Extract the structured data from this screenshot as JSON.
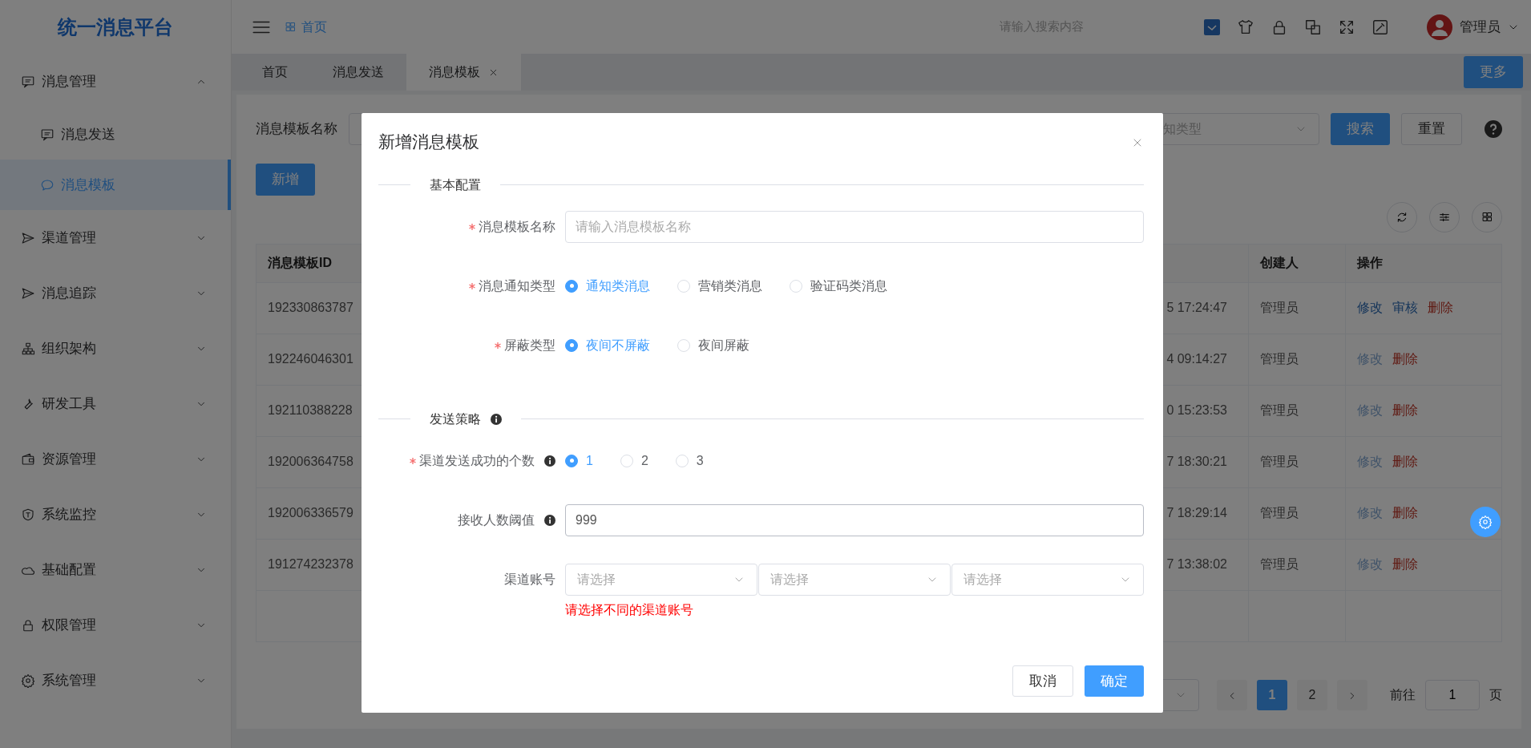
{
  "app": {
    "title": "统一消息平台"
  },
  "header": {
    "breadcrumb": "首页",
    "search_placeholder": "请输入搜索内容",
    "user": "管理员"
  },
  "sidebar": {
    "items": [
      {
        "label": "消息管理",
        "selected": false,
        "expanded": true,
        "children": [
          {
            "label": "消息发送",
            "selected": false
          },
          {
            "label": "消息模板",
            "selected": true
          }
        ]
      },
      {
        "label": "渠道管理",
        "selected": false,
        "expanded": false
      },
      {
        "label": "消息追踪",
        "selected": false,
        "expanded": false
      },
      {
        "label": "组织架构",
        "selected": false,
        "expanded": false
      },
      {
        "label": "研发工具",
        "selected": false,
        "expanded": false
      },
      {
        "label": "资源管理",
        "selected": false,
        "expanded": false
      },
      {
        "label": "系统监控",
        "selected": false,
        "expanded": false
      },
      {
        "label": "基础配置",
        "selected": false,
        "expanded": false
      },
      {
        "label": "权限管理",
        "selected": false,
        "expanded": false
      },
      {
        "label": "系统管理",
        "selected": false,
        "expanded": false
      }
    ]
  },
  "tabs": [
    {
      "label": "首页",
      "selected": false,
      "closable": false
    },
    {
      "label": "消息发送",
      "selected": false,
      "closable": false
    },
    {
      "label": "消息模板",
      "selected": true,
      "closable": true
    }
  ],
  "more_button": "更多",
  "filter": {
    "label": "消息模板名称",
    "type_placeholder": "知类型",
    "search_button": "搜索",
    "reset_button": "重置"
  },
  "add_button": "新增",
  "table": {
    "columns": [
      {
        "label": "消息模板ID"
      },
      {
        "label": "创建人"
      },
      {
        "label": "操作"
      }
    ],
    "rows": [
      {
        "id": "192330863787",
        "time": "5 17:24:47",
        "creator": "管理员",
        "actions": [
          {
            "label": "修改",
            "kind": "edit",
            "disabled": false
          },
          {
            "label": "审核",
            "kind": "edit",
            "disabled": false
          },
          {
            "label": "删除",
            "kind": "delete",
            "disabled": false
          }
        ]
      },
      {
        "id": "192246046301",
        "time": "4 09:14:27",
        "creator": "管理员",
        "actions": [
          {
            "label": "修改",
            "kind": "edit",
            "disabled": true
          },
          {
            "label": "删除",
            "kind": "delete",
            "disabled": false
          }
        ]
      },
      {
        "id": "192110388228",
        "time": "0 15:23:53",
        "creator": "管理员",
        "actions": [
          {
            "label": "修改",
            "kind": "edit",
            "disabled": true
          },
          {
            "label": "删除",
            "kind": "delete",
            "disabled": false
          }
        ]
      },
      {
        "id": "192006364758",
        "time": "7 18:30:21",
        "creator": "管理员",
        "actions": [
          {
            "label": "修改",
            "kind": "edit",
            "disabled": true
          },
          {
            "label": "删除",
            "kind": "delete",
            "disabled": false
          }
        ]
      },
      {
        "id": "192006336579",
        "time": "7 18:29:14",
        "creator": "管理员",
        "actions": [
          {
            "label": "修改",
            "kind": "edit",
            "disabled": true
          },
          {
            "label": "删除",
            "kind": "delete",
            "disabled": false
          }
        ]
      },
      {
        "id": "191274232378",
        "time": "7 13:38:02",
        "creator": "管理员",
        "actions": [
          {
            "label": "修改",
            "kind": "edit",
            "disabled": true
          },
          {
            "label": "删除",
            "kind": "delete",
            "disabled": false
          }
        ]
      }
    ]
  },
  "pagination": {
    "pages": [
      {
        "label": "1",
        "selected": true
      },
      {
        "label": "2",
        "selected": false
      }
    ],
    "goto_label": "前往",
    "goto_value": "1",
    "page_suffix": "页"
  },
  "dialog": {
    "title": "新增消息模板",
    "sections": [
      {
        "title": "基本配置",
        "info": false,
        "fields": [
          {
            "kind": "text",
            "label": "消息模板名称",
            "required": true,
            "info": false,
            "placeholder": "请输入消息模板名称"
          },
          {
            "kind": "radio",
            "label": "消息通知类型",
            "required": true,
            "info": false,
            "options": [
              {
                "label": "通知类消息",
                "selected": true
              },
              {
                "label": "营销类消息",
                "selected": false
              },
              {
                "label": "验证码类消息",
                "selected": false
              }
            ]
          },
          {
            "kind": "radio",
            "label": "屏蔽类型",
            "required": true,
            "info": false,
            "options": [
              {
                "label": "夜间不屏蔽",
                "selected": true
              },
              {
                "label": "夜间屏蔽",
                "selected": false
              }
            ]
          }
        ]
      },
      {
        "title": "发送策略",
        "info": true,
        "fields": [
          {
            "kind": "radio",
            "label": "渠道发送成功的个数",
            "required": true,
            "info": true,
            "options": [
              {
                "label": "1",
                "selected": true
              },
              {
                "label": "2",
                "selected": false
              },
              {
                "label": "3",
                "selected": false
              }
            ]
          },
          {
            "kind": "text",
            "label": "接收人数阈值",
            "required": false,
            "info": true,
            "value": "999"
          },
          {
            "kind": "selects",
            "label": "渠道账号",
            "required": false,
            "info": false,
            "selects": [
              {
                "placeholder": "请选择"
              },
              {
                "placeholder": "请选择"
              },
              {
                "placeholder": "请选择"
              }
            ],
            "error": "请选择不同的渠道账号"
          }
        ]
      }
    ],
    "cancel_button": "取消",
    "confirm_button": "确定"
  }
}
